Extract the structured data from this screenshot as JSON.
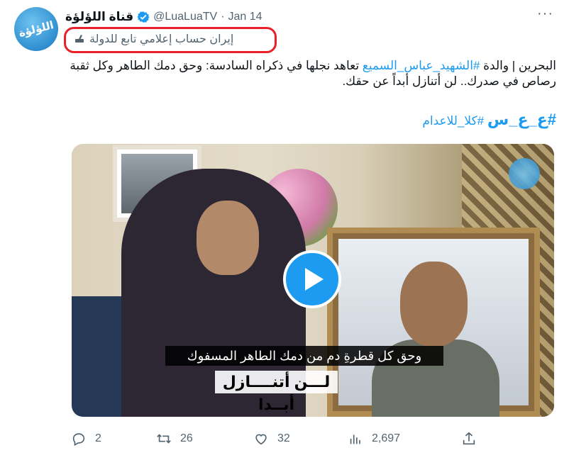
{
  "account": {
    "display_name": "قناة اللؤلؤة",
    "handle": "@LuaLuaTV",
    "separator": "·",
    "date": "Jan 14",
    "avatar_text": "اللؤلؤة"
  },
  "label": {
    "text": "إيران حساب إعلامي تابع للدولة"
  },
  "tweet": {
    "prefix": "البحرين | والدة ",
    "hashtag": "#الشهيد_عباس_السميع",
    "body": " تعاهد نجلها في ذكراه السادسة: وحق دمك الطاهر وكل ثقبة رصاص في صدرك.. لن أتنازل أبداً عن حقك."
  },
  "hashtags": {
    "first": "#ع_ع_س",
    "second": "#كلا_للاعدام"
  },
  "media": {
    "caption_line1": "وحق كل قطرةِ دم من دمك الطاهر المسفوك",
    "caption_line2": "لـــن أتنــــازل أبــدا"
  },
  "actions": {
    "replies": "2",
    "retweets": "26",
    "likes": "32",
    "views": "2,697"
  },
  "icons": {
    "verified": "verified-badge-icon",
    "more": "more-dots-icon",
    "reply": "reply-icon",
    "retweet": "retweet-icon",
    "like": "heart-icon",
    "views": "views-chart-icon",
    "share": "share-icon",
    "play": "play-icon",
    "label": "state-media-icon"
  },
  "colors": {
    "accent": "#1d9bf0",
    "muted": "#536471",
    "highlight_box": "#e8202a"
  }
}
